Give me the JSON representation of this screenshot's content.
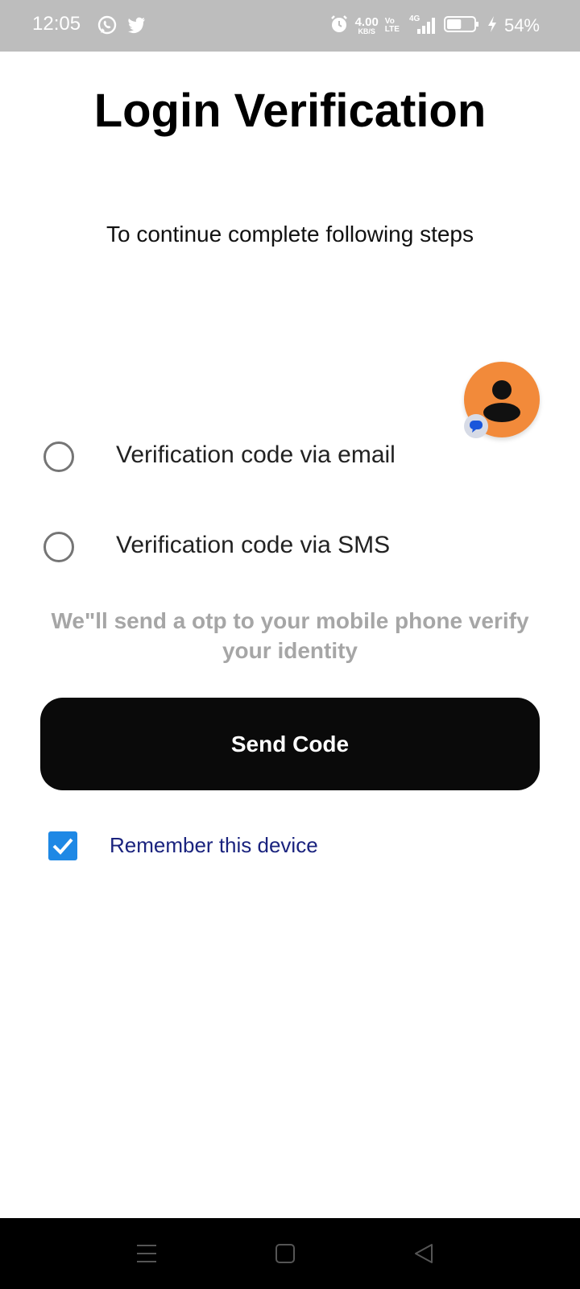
{
  "status_bar": {
    "time": "12:05",
    "left_icons": [
      "whatsapp-icon",
      "twitter-icon"
    ],
    "right_icons": [
      "alarm-icon",
      "volte-icon",
      "4g-signal-icon",
      "battery-icon",
      "charging-icon"
    ],
    "net_speed_value": "4.00",
    "net_speed_unit": "KB/S",
    "volte_top": "Vo",
    "volte_bottom": "LTE",
    "network_type": "4G",
    "battery_percent": "54%",
    "battery_level": 0.54
  },
  "header": {
    "title": "Login Verification",
    "subtitle": "To continue complete following steps"
  },
  "floating_avatar": {
    "icon": "person-icon",
    "badge_icon": "chat-bubble-icon",
    "color": "#f28a3a"
  },
  "options": [
    {
      "label": "Verification code via email",
      "selected": false
    },
    {
      "label": "Verification code via SMS",
      "selected": false
    }
  ],
  "hint": "We\"ll send a otp to your mobile phone verify your identity",
  "send_button": {
    "label": "Send Code"
  },
  "remember_device": {
    "label": "Remember this device",
    "checked": true
  },
  "nav_bar": {
    "icons": [
      "menu-icon",
      "home-icon",
      "back-icon"
    ]
  },
  "colors": {
    "accent": "#1e88e5",
    "button_bg": "#0a0a0a",
    "link_text": "#1a237e",
    "hint_text": "#a6a6a6",
    "status_bar_bg": "#bdbdbd"
  }
}
